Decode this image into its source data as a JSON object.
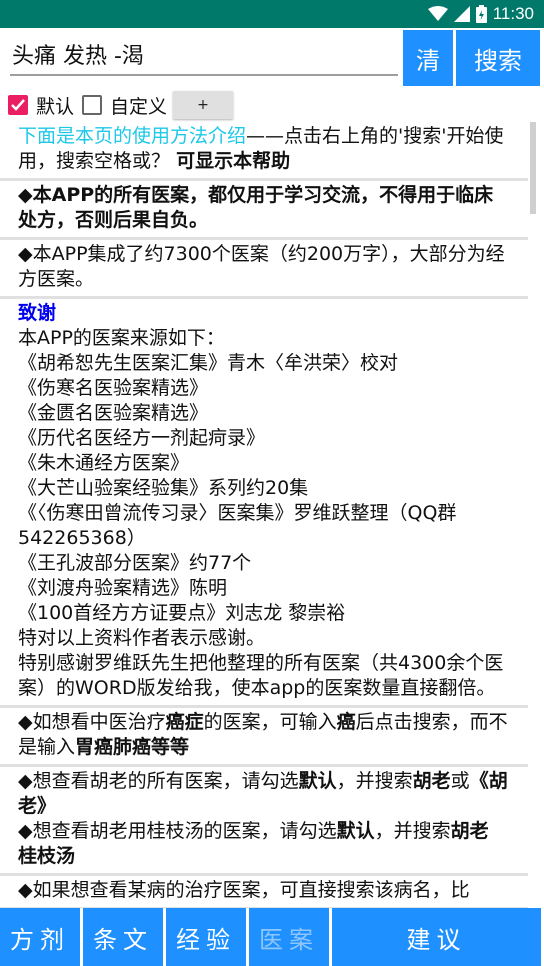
{
  "status": {
    "time": "11:30",
    "icons": [
      "wifi-icon",
      "signal-icon",
      "battery-icon"
    ]
  },
  "search": {
    "value": "头痛 发热 -渴",
    "clear_label": "清",
    "search_label": "搜索"
  },
  "options": {
    "default_label": "默认",
    "custom_label": "自定义",
    "plus_label": "+",
    "default_checked": true,
    "custom_checked": false
  },
  "content": {
    "intro_link": "下面是本页的使用方法介绍",
    "intro_rest": "——点击右上角的'搜索'开始使用，搜索空格或？",
    "intro_bold": "可显示本帮助",
    "disclaimer": "◆本APP的所有医案，都仅用于学习交流，不得用于临床处方，否则后果自负。",
    "collection": "◆本APP集成了约7300个医案（约200万字），大部分为经方医案。",
    "thanks_title": "致谢",
    "sources_intro": "本APP的医案来源如下：",
    "sources": [
      "《胡希恕先生医案汇集》青木〈牟洪荣〉校对",
      "《伤寒名医验案精选》",
      "《金匮名医验案精选》",
      "《历代名医经方一剂起疴录》",
      "《朱木通经方医案》",
      "《大芒山验案经验集》系列约20集",
      "《〈伤寒田曾流传习录〉医案集》罗维跃整理（QQ群542265368）",
      "《王孔波部分医案》约77个",
      "《刘渡舟验案精选》陈明",
      "《100首经方方证要点》刘志龙 黎崇裕"
    ],
    "thanks_authors": "特对以上资料作者表示感谢。",
    "thanks_special": "特别感谢罗维跃先生把他整理的所有医案（共4300余个医案）的WORD版发给我，使本app的医案数量直接翻倍。",
    "tip_cancer": {
      "p1": "◆如想看中医治疗",
      "b1": "癌症",
      "p2": "的医案，可输入",
      "b2": "癌",
      "p3": "后点击搜索，而不是输入",
      "b3": "胃癌肺癌等等"
    },
    "tip_hu": {
      "p1": "◆想查看胡老的所有医案，请勾选",
      "b1": "默认",
      "p2": "，并搜索",
      "b2": "胡老",
      "p3": "或",
      "b3": "《胡老》"
    },
    "tip_hu_gz": {
      "p1": "◆想查看胡老用桂枝汤的医案，请勾选",
      "b1": "默认",
      "p2": "，并搜索",
      "b2": "胡老 桂枝汤"
    },
    "tip_disease": "◆如果想查看某病的治疗医案，可直接搜索该病名，比"
  },
  "tabs": [
    {
      "label": "方剂",
      "enabled": true
    },
    {
      "label": "条文",
      "enabled": true
    },
    {
      "label": "经验",
      "enabled": true
    },
    {
      "label": "医案",
      "enabled": false
    },
    {
      "label": "建议",
      "enabled": true
    }
  ]
}
